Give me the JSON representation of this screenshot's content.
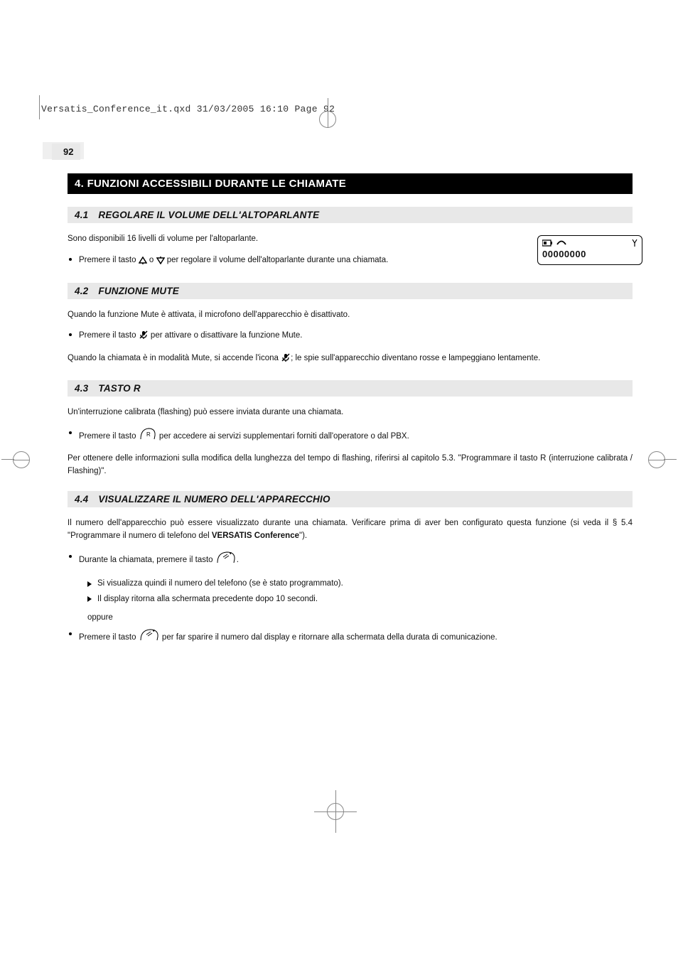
{
  "print_header": "Versatis_Conference_it.qxd  31/03/2005  16:10  Page 92",
  "page_number": "92",
  "heading_main": "4.   FUNZIONI ACCESSIBILI DURANTE LE CHIAMATE",
  "s41": {
    "num": "4.1",
    "title": "REGOLARE IL VOLUME DELL'ALTOPARLANTE",
    "p1": "Sono disponibili 16 livelli di volume per l'altoparlante.",
    "b1_pre": "Premere il tasto ",
    "b1_mid": " o ",
    "b1_post": " per regolare il volume dell'altoparlante durante una chiamata."
  },
  "lcd_value": "00000000",
  "s42": {
    "num": "4.2",
    "title": "FUNZIONE MUTE",
    "p1": "Quando la funzione Mute è attivata, il microfono dell'apparecchio è disattivato.",
    "b1_pre": "Premere il tasto ",
    "b1_post": " per attivare o disattivare la funzione Mute.",
    "p2_pre": "Quando la chiamata è in modalità Mute, si accende l'icona ",
    "p2_post": "; le spie sull'apparecchio diventano rosse e lampeggiano lentamente."
  },
  "s43": {
    "num": "4.3",
    "title": "TASTO R",
    "p1": "Un'interruzione calibrata (flashing) può essere inviata durante una chiamata.",
    "b1_pre": "Premere il tasto ",
    "b1_post": " per accedere ai servizi supplementari forniti dall'operatore o dal PBX.",
    "p2": "Per ottenere delle informazioni sulla modifica della lunghezza del tempo di flashing, riferirsi al capitolo 5.3. \"Programmare il tasto R (interruzione calibrata / Flashing)\"."
  },
  "s44": {
    "num": "4.4",
    "title": "VISUALIZZARE IL NUMERO DELL'APPARECCHIO",
    "p1_pre": "Il numero dell'apparecchio può essere visualizzato durante una chiamata. Verificare prima di aver ben configurato questa funzione (si veda il § 5.4 \"Programmare il numero di telefono del ",
    "p1_bold": "VERSATIS Conference",
    "p1_post": "\").",
    "b1_pre": "Durante la chiamata, premere il tasto ",
    "b1_post": ".",
    "sub1": "Si visualizza quindi il numero del telefono (se è stato programmato).",
    "sub2": "Il display ritorna alla schermata precedente dopo 10 secondi.",
    "oppure": "oppure",
    "b2_pre": "Premere il tasto ",
    "b2_post": " per far sparire il numero dal display e ritornare alla schermata della durata di comunicazione."
  }
}
